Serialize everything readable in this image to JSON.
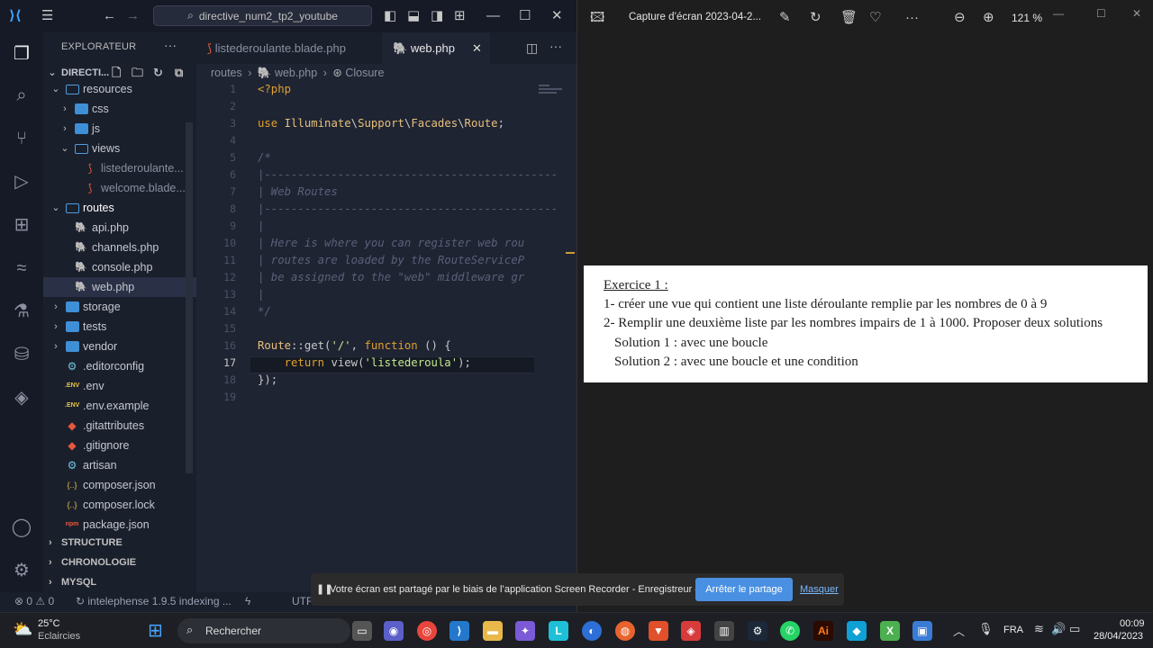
{
  "vscode": {
    "search_box": "directive_num2_tp2_youtube",
    "explorer_title": "EXPLORATEUR",
    "project_name": "DIRECTI...",
    "tree": [
      {
        "label": "resources",
        "type": "folder-open",
        "indent": 1
      },
      {
        "label": "css",
        "type": "folder",
        "indent": 2
      },
      {
        "label": "js",
        "type": "folder",
        "indent": 2
      },
      {
        "label": "views",
        "type": "folder-open",
        "indent": 2
      },
      {
        "label": "listederoulante...",
        "type": "blade",
        "indent": 3
      },
      {
        "label": "welcome.blade...",
        "type": "blade",
        "indent": 3
      },
      {
        "label": "routes",
        "type": "folder-open",
        "indent": 1
      },
      {
        "label": "api.php",
        "type": "php",
        "indent": 2
      },
      {
        "label": "channels.php",
        "type": "php",
        "indent": 2
      },
      {
        "label": "console.php",
        "type": "php",
        "indent": 2
      },
      {
        "label": "web.php",
        "type": "php",
        "indent": 2
      },
      {
        "label": "storage",
        "type": "folder",
        "indent": 1
      },
      {
        "label": "tests",
        "type": "folder",
        "indent": 1
      },
      {
        "label": "vendor",
        "type": "folder",
        "indent": 1
      },
      {
        "label": ".editorconfig",
        "type": "file",
        "indent": 1
      },
      {
        "label": ".env",
        "type": "env",
        "indent": 1
      },
      {
        "label": ".env.example",
        "type": "env",
        "indent": 1
      },
      {
        "label": ".gitattributes",
        "type": "git",
        "indent": 1
      },
      {
        "label": ".gitignore",
        "type": "git",
        "indent": 1
      },
      {
        "label": "artisan",
        "type": "file",
        "indent": 1
      },
      {
        "label": "composer.json",
        "type": "json",
        "indent": 1
      },
      {
        "label": "composer.lock",
        "type": "json",
        "indent": 1
      },
      {
        "label": "package.json",
        "type": "npm",
        "indent": 1
      }
    ],
    "selected_item": "web.php",
    "sections": [
      "STRUCTURE",
      "CHRONOLOGIE",
      "MYSQL"
    ],
    "tabs": [
      {
        "label": "listederoulante.blade.php",
        "active": false
      },
      {
        "label": "web.php",
        "active": true
      }
    ],
    "breadcrumbs": [
      "routes",
      "web.php",
      "Closure"
    ],
    "code_lines": [
      "<?php",
      "",
      "use Illuminate\\Support\\Facades\\Route;",
      "",
      "/*",
      "|--------------------------------------------",
      "| Web Routes",
      "|--------------------------------------------",
      "|",
      "| Here is where you can register web rou",
      "| routes are loaded by the RouteServiceP",
      "| be assigned to the \"web\" middleware gr",
      "|",
      "*/",
      "",
      "Route::get('/', function () {",
      "    return view('listederoula');",
      "});",
      ""
    ],
    "current_line": 17,
    "status": {
      "errors": "0",
      "warnings": "0",
      "indexing": "intelephense 1.9.5 indexing ...",
      "encoding": "UTF"
    }
  },
  "viewer": {
    "title": "Capture d’écran 2023-04-2...",
    "zoom": "121 %",
    "document_lines": [
      "Exercice 1 :",
      "1- créer une vue qui contient une liste déroulante remplie par les nombres de 0 à 9",
      "2- Remplir une deuxième liste par les nombres impairs de 1 à 1000. Proposer deux solutions",
      "Solution 1 : avec une boucle",
      "Solution 2 : avec une boucle et une condition"
    ]
  },
  "share_bar": {
    "message": "Votre écran est partagé par le biais de l’application Screen Recorder - Enregistreur d’écran.",
    "stop_button": "Arrêter le partage",
    "hide_link": "Masquer"
  },
  "taskbar": {
    "weather_temp": "25°C",
    "weather_desc": "Eclaircies",
    "search_label": "Rechercher",
    "language": "FRA",
    "time": "00:09",
    "date": "28/04/2023"
  }
}
